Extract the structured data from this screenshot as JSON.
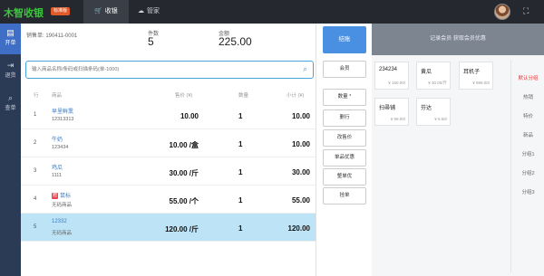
{
  "app": {
    "logo": "木智收银",
    "logo_badge": "标准版",
    "tabs": [
      {
        "label": "收银",
        "icon": "cart-icon"
      },
      {
        "label": "管家",
        "icon": "cloud-icon"
      }
    ]
  },
  "sidebar": {
    "items": [
      {
        "label": "开单",
        "icon": "receipt-icon"
      },
      {
        "label": "退货",
        "icon": "return-icon"
      },
      {
        "label": "查单",
        "icon": "search-icon"
      }
    ]
  },
  "order": {
    "number_label": "销售单:",
    "number": "190411-0001",
    "count_label": "件数",
    "count": "5",
    "amount_label": "金额",
    "amount": "225.00"
  },
  "search": {
    "placeholder": "输入商品名称/条码或扫描条码(单-1000)"
  },
  "table": {
    "headers": [
      "行",
      "商品",
      "售价 (¥)",
      "数量",
      "小计 (¥)"
    ],
    "rows": [
      {
        "idx": "1",
        "name": "早里鲜熏",
        "code": "12313313",
        "price": "10.00",
        "qty": "1",
        "subtotal": "10.00",
        "gift": false
      },
      {
        "idx": "2",
        "name": "牛奶",
        "code": "123434",
        "price": "10.00 /盒",
        "qty": "1",
        "subtotal": "10.00",
        "gift": false
      },
      {
        "idx": "3",
        "name": "鸡瓜",
        "code": "1111",
        "price": "30.00 /斤",
        "qty": "1",
        "subtotal": "30.00",
        "gift": false
      },
      {
        "idx": "4",
        "name": "鼠标",
        "code": "无码商品",
        "price": "55.00 /个",
        "qty": "1",
        "subtotal": "55.00",
        "gift": true,
        "gift_label": "赠"
      },
      {
        "idx": "5",
        "name": "12332",
        "code": "无码商品",
        "price": "120.00 /斤",
        "qty": "1",
        "subtotal": "120.00",
        "gift": false
      }
    ]
  },
  "actions": {
    "checkout": "结账",
    "member": "会员",
    "quantity": "数量 *",
    "delete": "删行",
    "change_price": "改售价",
    "single_discount": "单品优惠",
    "whole_discount": "整单优",
    "hang": "挂单"
  },
  "right": {
    "banner": "记录会员 获取会员优惠",
    "products": [
      {
        "name": "234234",
        "price": "¥ 150.00/"
      },
      {
        "name": "黄瓜",
        "price": "¥ 30.00/斤"
      },
      {
        "name": "耳机子",
        "price": "¥ 999.00/"
      },
      {
        "name": "扫帚铺",
        "price": "¥ 99.00/"
      },
      {
        "name": "芬达",
        "price": "¥ 6.50/"
      }
    ],
    "categories": [
      "默认分组",
      "热销",
      "特价",
      "新品",
      "分组1",
      "分组2",
      "分组3"
    ]
  },
  "colors": {
    "accent": "#4a90e2",
    "sidebar_bg": "#2b3a55",
    "topbar_bg": "#25282f",
    "selected_row": "#bde3f6",
    "logo_green": "#3ec43e"
  }
}
